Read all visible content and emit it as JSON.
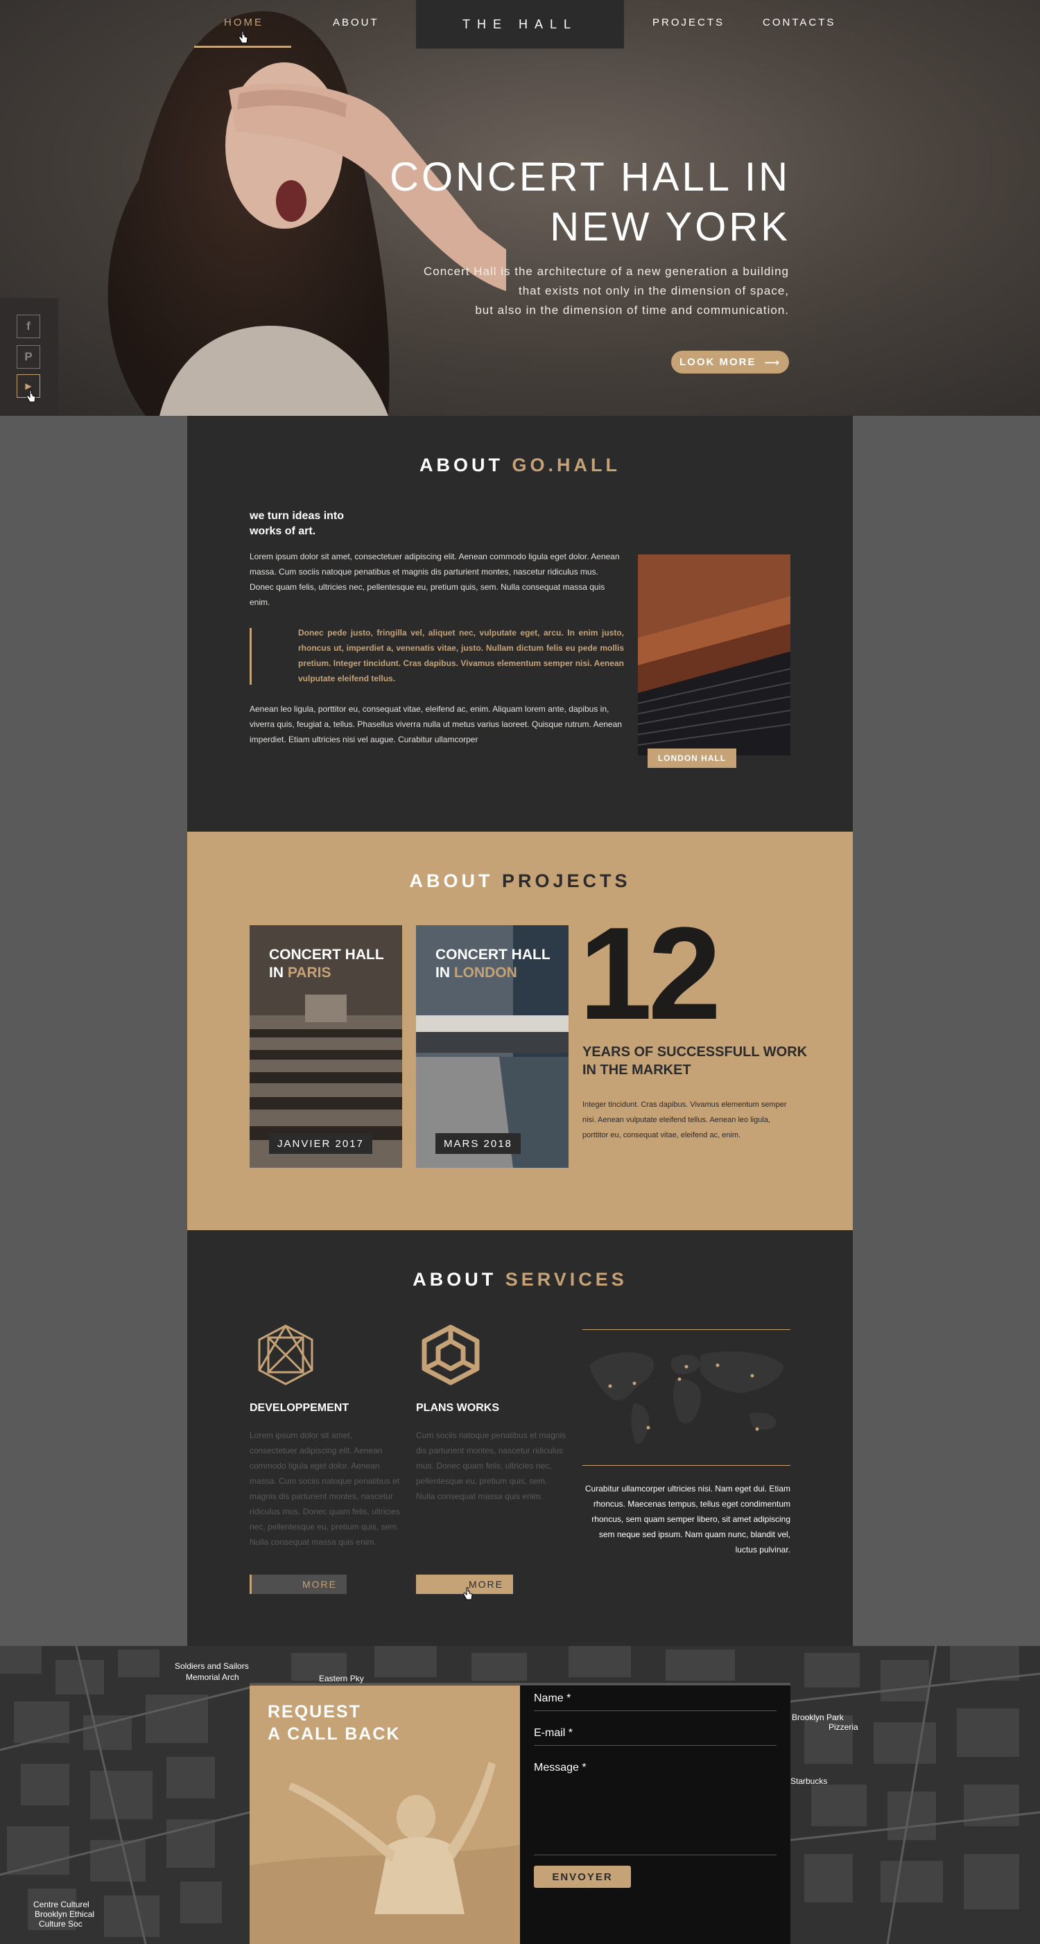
{
  "nav": {
    "items": [
      {
        "label": "HOME",
        "active": true
      },
      {
        "label": "ABOUT",
        "active": false
      },
      {
        "label": "PROJECTS",
        "active": false
      },
      {
        "label": "CONTACTS",
        "active": false
      }
    ],
    "logo": "THE HALL"
  },
  "hero": {
    "title_line1": "CONCERT HALL IN",
    "title_line2": "NEW YORK",
    "text_line1": "Concert Hall is the architecture of a new generation a building",
    "text_line2": "that exists not only in the dimension of space,",
    "text_line3": "but also in the dimension of time and communication.",
    "button": "LOOK MORE",
    "button_arrow": "⟶"
  },
  "social": [
    {
      "icon": "facebook-icon",
      "glyph": "f"
    },
    {
      "icon": "pinterest-icon",
      "glyph": "P"
    },
    {
      "icon": "youtube-icon",
      "glyph": "▶"
    }
  ],
  "about": {
    "title_a": "ABOUT ",
    "title_b": "GO.HALL",
    "subtitle_line1": "we turn ideas into",
    "subtitle_line2": "works of art.",
    "para1": "Lorem ipsum dolor sit amet, consectetuer adipiscing elit. Aenean commodo ligula eget dolor. Aenean massa. Cum sociis natoque penatibus et magnis dis parturient montes, nascetur ridiculus mus. Donec quam felis, ultricies nec, pellentesque eu, pretium quis, sem. Nulla consequat massa quis enim.",
    "quote": "Donec pede justo, fringilla vel, aliquet nec, vulputate eget, arcu. In enim justo, rhoncus ut, imperdiet a, venenatis vitae, justo. Nullam dictum felis eu pede mollis pretium. Integer tincidunt. Cras dapibus. Vivamus elementum semper nisi. Aenean vulputate eleifend tellus.",
    "para2": "Aenean leo ligula, porttitor eu, consequat vitae, eleifend ac, enim. Aliquam lorem ante, dapibus in, viverra quis, feugiat a, tellus. Phasellus viverra nulla ut metus varius laoreet. Quisque rutrum. Aenean imperdiet. Etiam ultricies nisi vel augue. Curabitur ullamcorper",
    "image_badge": "LONDON HALL"
  },
  "projects": {
    "title_a": "ABOUT ",
    "title_b": "PROJECTS",
    "cards": [
      {
        "line1": "CONCERT HALL",
        "line2_a": "IN ",
        "line2_b": "PARIS",
        "date": "JANVIER 2017"
      },
      {
        "line1": "CONCERT HALL",
        "line2_a": "IN ",
        "line2_b": "LONDON",
        "date": "MARS 2018"
      }
    ],
    "big_number": "12",
    "years_title_line1": "YEARS OF SUCCESSFULL WORK",
    "years_title_line2": "IN THE MARKET",
    "years_text": "Integer tincidunt. Cras dapibus. Vivamus elementum semper nisi. Aenean vulputate eleifend tellus. Aenean leo ligula, porttitor eu, consequat vitae, eleifend ac, enim."
  },
  "services": {
    "title_a": "ABOUT ",
    "title_b": "SERVICES",
    "items": [
      {
        "icon": "hexagon-lattice-icon",
        "title": "DEVELOPPEMENT",
        "text": "Lorem ipsum dolor sit amet, consectetuer adipiscing elit. Aenean commodo ligula eget dolor. Aenean massa. Cum sociis natoque penatibus et magnis dis parturient montes, nascetur ridiculus mus. Donec quam felis, ultricies nec, pellentesque eu, pretium quis, sem. Nulla consequat massa quis enim.",
        "button": "MORE"
      },
      {
        "icon": "cube-icon",
        "title": "PLANS WORKS",
        "text": "Cum sociis natoque penatibus et magnis dis parturient montes, nascetur ridiculus mus. Donec quam felis, ultricies nec, pellentesque eu, pretium quis, sem. Nulla consequat massa quis enim.",
        "button": "MORE"
      }
    ],
    "map_text": "Curabitur ullamcorper ultricies nisi. Nam eget dui. Etiam rhoncus. Maecenas tempus, tellus eget condimentum rhoncus, sem quam semper libero, sit amet adipiscing sem neque sed ipsum. Nam quam nunc, blandit vel, luctus pulvinar."
  },
  "contact": {
    "title_line1": "REQUEST",
    "title_line2": "A CALL BACK",
    "fields": [
      {
        "label": "Name *"
      },
      {
        "label": "E-mail *"
      },
      {
        "label": "Message *"
      }
    ],
    "submit": "ENVOYER",
    "map_labels": [
      "Soldiers and Sailors",
      "Memorial Arch",
      "Eastern Pky",
      "Starbucks",
      "Pizzeria",
      "Brooklyn Park",
      "Centre Culturel",
      "Brooklyn Ethical",
      "Culture Soc"
    ]
  },
  "colors": {
    "accent": "#c6a277",
    "dark": "#2b2b2c",
    "page": "#5a5a5b"
  }
}
